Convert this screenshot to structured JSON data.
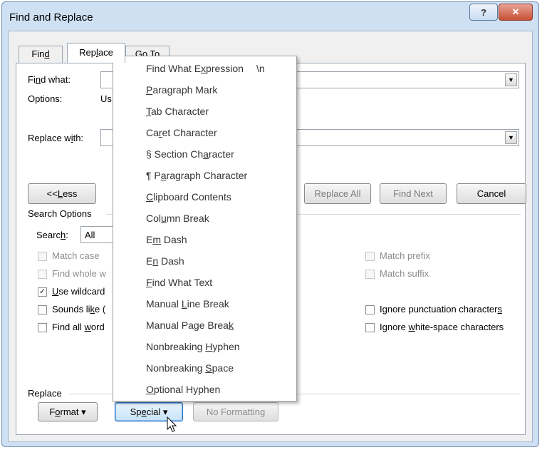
{
  "window": {
    "title": "Find and Replace",
    "help_icon": "question-mark",
    "close_icon": "x"
  },
  "tabs": [
    {
      "pre": "Fin",
      "acc": "d",
      "post": "",
      "active": false
    },
    {
      "pre": "Rep",
      "acc": "l",
      "post": "ace",
      "active": true
    },
    {
      "pre": "",
      "acc": "G",
      "post": "o To",
      "active": false
    }
  ],
  "find": {
    "pre": "Fi",
    "acc": "n",
    "post": "d what:",
    "value": ""
  },
  "options": {
    "label": "Options:",
    "value": "Us"
  },
  "replace_with": {
    "pre": "Replace w",
    "acc": "i",
    "post": "th:",
    "value": ""
  },
  "buttons": {
    "less": {
      "pre": "<< ",
      "acc": "L",
      "post": "ess"
    },
    "replace_all": "Replace All",
    "find_next": "Find Next",
    "cancel": "Cancel"
  },
  "search_options": {
    "heading": "Search Options",
    "search": {
      "pre": "Searc",
      "acc": "h",
      "post": ":",
      "value": "All"
    }
  },
  "checkboxes_left": [
    {
      "text": "Match case",
      "checked": false,
      "disabled": true
    },
    {
      "text": "Find whole w",
      "checked": false,
      "disabled": true
    },
    {
      "pre": "",
      "acc": "U",
      "post": "se wildcard",
      "checked": true,
      "disabled": false
    },
    {
      "pre": "Sounds li",
      "acc": "k",
      "post": "e (",
      "checked": false,
      "disabled": false
    },
    {
      "pre": "Find all ",
      "acc": "w",
      "post": "ord",
      "checked": false,
      "disabled": false
    }
  ],
  "checkboxes_right": [
    {
      "text": "Match prefix",
      "checked": false,
      "disabled": true
    },
    {
      "text": "Match suffix",
      "checked": false,
      "disabled": true
    },
    {
      "pre": "Ignore punctuation character",
      "acc": "s",
      "post": "",
      "checked": false,
      "disabled": false
    },
    {
      "pre": "Ignore ",
      "acc": "w",
      "post": "hite-space characters",
      "checked": false,
      "disabled": false
    }
  ],
  "replace_section": {
    "heading": "Replace",
    "format": {
      "pre": "F",
      "acc": "o",
      "post": "rmat",
      "arrow": "▾"
    },
    "special": {
      "pre": "Sp",
      "acc": "e",
      "post": "cial",
      "arrow": "▾"
    },
    "no_formatting": "No Formatting"
  },
  "special_menu": [
    {
      "pre": "Find What E",
      "acc": "x",
      "post": "pression",
      "shortcut": "\\n"
    },
    {
      "pre": "",
      "acc": "P",
      "post": "aragraph Mark",
      "shortcut": ""
    },
    {
      "pre": "",
      "acc": "T",
      "post": "ab Character",
      "shortcut": ""
    },
    {
      "pre": "Ca",
      "acc": "r",
      "post": "et Character",
      "shortcut": ""
    },
    {
      "pre": "§ Section Ch",
      "acc": "a",
      "post": "racter",
      "shortcut": ""
    },
    {
      "pre": "¶ P",
      "acc": "a",
      "post": "ragraph Character",
      "shortcut": ""
    },
    {
      "pre": "",
      "acc": "C",
      "post": "lipboard Contents",
      "shortcut": ""
    },
    {
      "pre": "Col",
      "acc": "u",
      "post": "mn Break",
      "shortcut": ""
    },
    {
      "pre": "E",
      "acc": "m",
      "post": " Dash",
      "shortcut": ""
    },
    {
      "pre": "E",
      "acc": "n",
      "post": " Dash",
      "shortcut": ""
    },
    {
      "pre": "",
      "acc": "F",
      "post": "ind What Text",
      "shortcut": ""
    },
    {
      "pre": "Manual ",
      "acc": "L",
      "post": "ine Break",
      "shortcut": ""
    },
    {
      "pre": "Manual Page Brea",
      "acc": "k",
      "post": "",
      "shortcut": ""
    },
    {
      "pre": "Nonbreaking ",
      "acc": "H",
      "post": "yphen",
      "shortcut": ""
    },
    {
      "pre": "Nonbreaking ",
      "acc": "S",
      "post": "pace",
      "shortcut": ""
    },
    {
      "pre": "",
      "acc": "O",
      "post": "ptional Hyphen",
      "shortcut": ""
    }
  ],
  "colors": {
    "title_bar": "#cfe0f3",
    "close_button": "#c84f36",
    "focus_blue": "#2f74c7"
  }
}
